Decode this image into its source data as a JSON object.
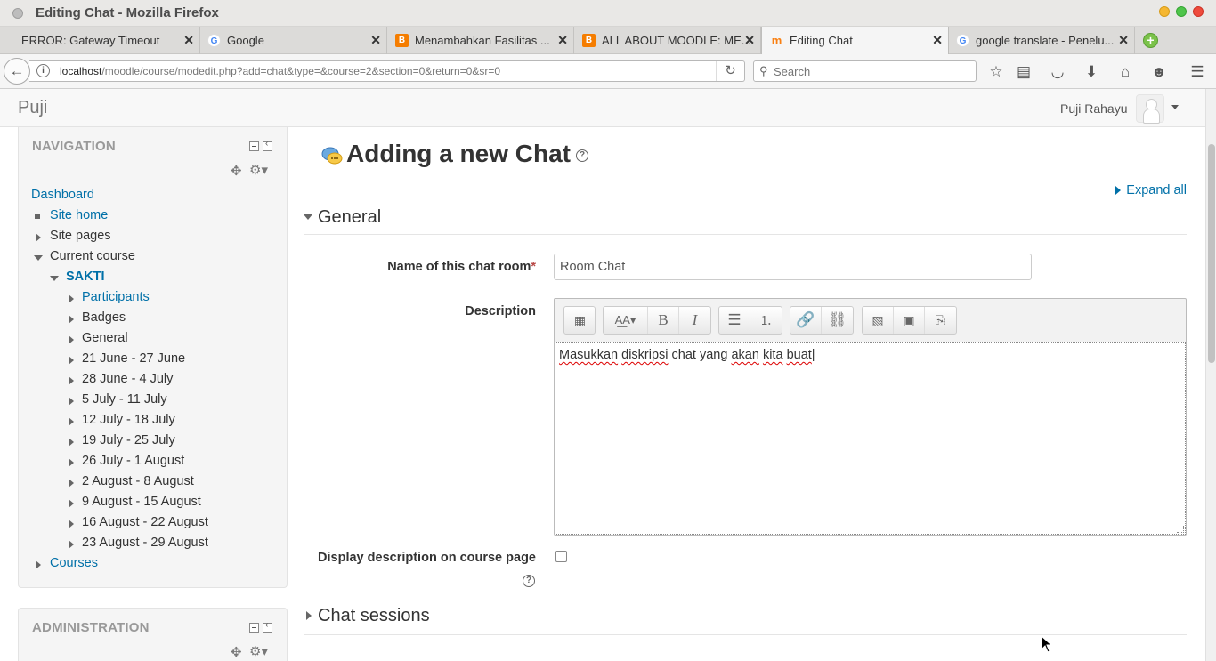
{
  "window": {
    "title": "Editing Chat - Mozilla Firefox"
  },
  "tabs": [
    {
      "label": "ERROR: Gateway Timeout",
      "icon": "none"
    },
    {
      "label": "Google",
      "icon": "google-icon"
    },
    {
      "label": "Menambahkan Fasilitas ...",
      "icon": "blogger-icon"
    },
    {
      "label": "ALL ABOUT MOODLE: ME...",
      "icon": "blogger-icon"
    },
    {
      "label": "Editing Chat",
      "icon": "moodle-icon"
    },
    {
      "label": "google translate - Penelu...",
      "icon": "google-icon"
    }
  ],
  "browser": {
    "url_host": "localhost",
    "url_path": "/moodle/course/modedit.php?add=chat&type=&course=2&section=0&return=0&sr=0",
    "search_placeholder": "Search"
  },
  "header": {
    "brand": "Puji",
    "user_name": "Puji Rahayu"
  },
  "navigation": {
    "heading": "NAVIGATION",
    "items": [
      {
        "label": "Dashboard"
      },
      {
        "label": "Site home"
      },
      {
        "label": "Site pages"
      },
      {
        "label": "Current course"
      },
      {
        "label": "SAKTI"
      },
      {
        "label": "Participants"
      },
      {
        "label": "Badges"
      },
      {
        "label": "General"
      },
      {
        "label": "21 June - 27 June"
      },
      {
        "label": "28 June - 4 July"
      },
      {
        "label": "5 July - 11 July"
      },
      {
        "label": "12 July - 18 July"
      },
      {
        "label": "19 July - 25 July"
      },
      {
        "label": "26 July - 1 August"
      },
      {
        "label": "2 August - 8 August"
      },
      {
        "label": "9 August - 15 August"
      },
      {
        "label": "16 August - 22 August"
      },
      {
        "label": "23 August - 29 August"
      },
      {
        "label": "Courses"
      }
    ]
  },
  "administration": {
    "heading": "ADMINISTRATION"
  },
  "main": {
    "title": "Adding a new Chat",
    "expand_all": "Expand all",
    "section_general": "General",
    "name_label": "Name of this chat room",
    "required_mark": "*",
    "name_value": "Room Chat",
    "description_label": "Description",
    "editor_words": [
      "Masukkan",
      "diskripsi",
      "chat",
      "yang",
      "akan",
      "kita",
      "buat"
    ],
    "display_label": "Display description on course page",
    "display_checked": false,
    "section_sessions": "Chat sessions"
  }
}
